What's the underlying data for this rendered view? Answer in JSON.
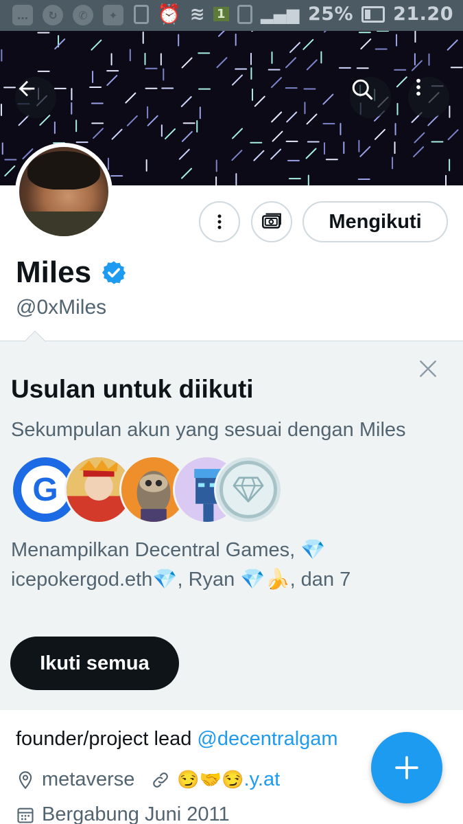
{
  "status_bar": {
    "battery": "25%",
    "time": "21.20",
    "signal_badge": "1"
  },
  "profile": {
    "name": "Miles",
    "handle": "@0xMiles",
    "following_label": "Mengikuti",
    "verified": true
  },
  "suggestions": {
    "title": "Usulan untuk diikuti",
    "subtitle": "Sekumpulan akun yang sesuai dengan Miles",
    "description": "Menampilkan Decentral Games, 💎 icepokergod.eth💎, Ryan 💎🍌, dan 7",
    "follow_all_label": "Ikuti semua",
    "avatar_1_letter": "G"
  },
  "bio": {
    "text": "founder/project lead ",
    "mention": "@decentralgam",
    "location": "metaverse",
    "link_emoji": "😏🤝😏",
    "link_text": ".y.at",
    "joined": "Bergabung Juni 2011"
  },
  "colors": {
    "accent": "#1d9bf0",
    "text_primary": "#0f1419",
    "text_secondary": "#536471",
    "suggest_bg": "#eff3f4",
    "status_bar_bg": "#4c5a63"
  },
  "icons": [
    "back-arrow-icon",
    "search-icon",
    "more-vertical-icon",
    "tip-jar-icon",
    "verified-badge-icon",
    "close-icon",
    "location-icon",
    "link-icon",
    "calendar-icon",
    "compose-plus-icon"
  ]
}
